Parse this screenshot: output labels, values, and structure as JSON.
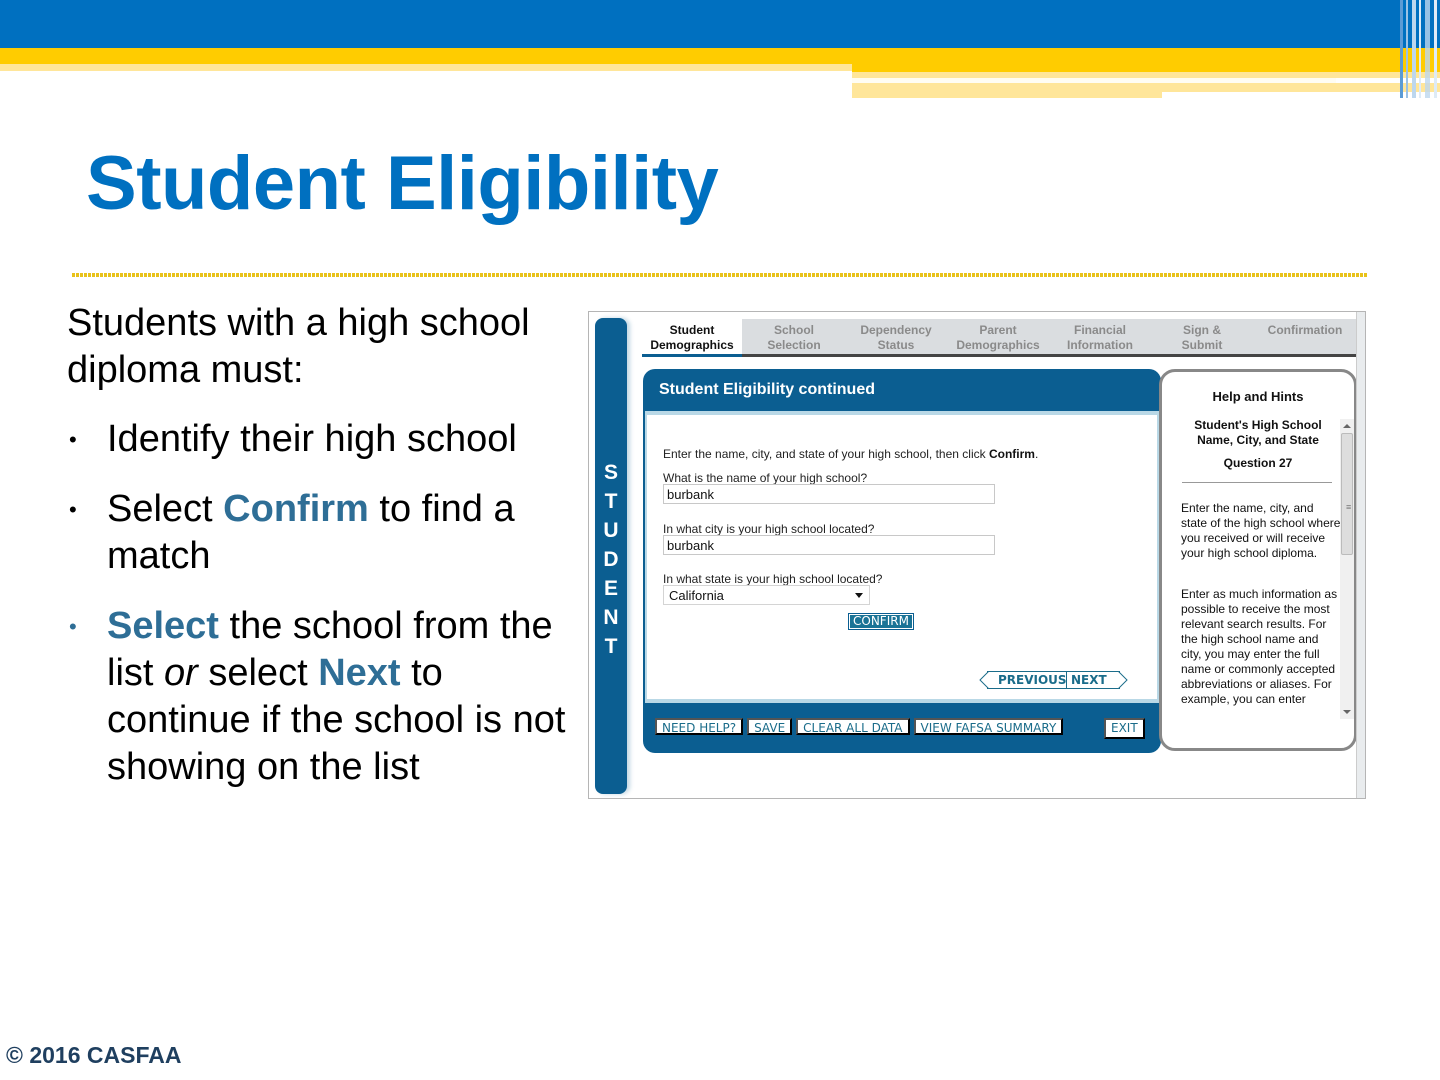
{
  "slide": {
    "title": "Student Eligibility",
    "intro": "Students with a high school diploma must:",
    "bullets": [
      {
        "parts": [
          {
            "text": "Identify their high school",
            "style": "normal"
          }
        ]
      },
      {
        "parts": [
          {
            "text": "Select ",
            "style": "normal"
          },
          {
            "text": "Confirm",
            "style": "highlight"
          },
          {
            "text": " to find a match",
            "style": "normal"
          }
        ]
      },
      {
        "parts": [
          {
            "text": "Select",
            "style": "highlight"
          },
          {
            "text": " the school from the list ",
            "style": "normal"
          },
          {
            "text": "or",
            "style": "italic"
          },
          {
            "text": " select ",
            "style": "normal"
          },
          {
            "text": "Next",
            "style": "highlight"
          },
          {
            "text": " to continue if the school is not showing on the list",
            "style": "normal"
          }
        ]
      }
    ],
    "bullet_glyph": "•",
    "footer": "© 2016 CASFAA",
    "colors": {
      "title": "#0070C0",
      "highlight": "#2E6E96",
      "band_blue": "#0070C0",
      "band_yellow": "#FFCC00"
    }
  },
  "fafsa": {
    "side_label": "STUDENT",
    "tabs": [
      {
        "line1": "Student",
        "line2": "Demographics",
        "active": true
      },
      {
        "line1": "School",
        "line2": "Selection",
        "active": false
      },
      {
        "line1": "Dependency",
        "line2": "Status",
        "active": false
      },
      {
        "line1": "Parent",
        "line2": "Demographics",
        "active": false
      },
      {
        "line1": "Financial",
        "line2": "Information",
        "active": false
      },
      {
        "line1": "Sign &",
        "line2": "Submit",
        "active": false
      },
      {
        "line1": "Confirmation",
        "line2": "",
        "active": false
      }
    ],
    "panel_title": "Student Eligibility continued",
    "instruction_prefix": "Enter the name, city, and state of your high school, then click ",
    "instruction_bold": "Confirm",
    "instruction_suffix": ".",
    "fields": {
      "name_label": "What is the name of your high school?",
      "name_value": "burbank",
      "city_label": "In what city is your high school located?",
      "city_value": "burbank",
      "state_label": "In what state is your high school located?",
      "state_value": "California"
    },
    "buttons": {
      "confirm": "CONFIRM",
      "previous": "PREVIOUS",
      "next": "NEXT",
      "need_help": "NEED HELP?",
      "save": "SAVE",
      "clear_all": "CLEAR ALL DATA",
      "view_summary": "VIEW FAFSA SUMMARY",
      "exit": "EXIT"
    },
    "help": {
      "title": "Help and Hints",
      "subtitle": "Student's High School Name, City, and State",
      "question": "Question 27",
      "para1": "Enter the name, city, and state of the high school where you received or will receive your high school diploma.",
      "para2": "Enter as much information as possible to receive the most relevant search results. For the high school name and city, you may enter the full name or commonly accepted abbreviations or aliases. For example, you can enter"
    },
    "colors": {
      "primary": "#0B5E91",
      "accent": "#1A7396"
    }
  }
}
